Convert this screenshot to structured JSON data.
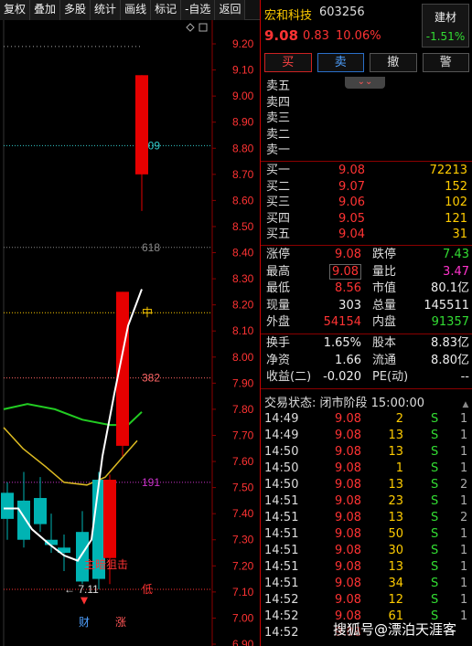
{
  "toolbar": {
    "buttons": [
      "复权",
      "叠加",
      "多股",
      "统计",
      "画线",
      "标记",
      "-自选",
      "返回"
    ]
  },
  "chart_data": {
    "type": "candlestick",
    "y_ticks": [
      "9.20",
      "9.10",
      "9.00",
      "8.90",
      "8.80",
      "8.70",
      "8.60",
      "8.50",
      "8.40",
      "8.30",
      "8.20",
      "8.10",
      "8.00",
      "7.90",
      "7.80",
      "7.70",
      "7.60",
      "7.50",
      "7.40",
      "7.30",
      "7.20",
      "7.10",
      "7.00",
      "6.90"
    ],
    "ylim": [
      6.9,
      9.25
    ],
    "candles": [
      {
        "open": 7.48,
        "close": 7.38,
        "high": 7.52,
        "low": 7.3
      },
      {
        "open": 7.45,
        "close": 7.3,
        "high": 7.56,
        "low": 7.27
      },
      {
        "open": 7.46,
        "close": 7.36,
        "high": 7.54,
        "low": 7.33
      },
      {
        "open": 7.3,
        "close": 7.28,
        "high": 7.4,
        "low": 7.25
      },
      {
        "open": 7.27,
        "close": 7.25,
        "high": 7.32,
        "low": 7.18
      },
      {
        "open": 7.33,
        "close": 7.14,
        "high": 7.41,
        "low": 7.13
      },
      {
        "open": 7.53,
        "close": 7.15,
        "high": 7.56,
        "low": 7.11
      },
      {
        "open": 7.23,
        "close": 7.53,
        "high": 7.55,
        "low": 7.13
      },
      {
        "open": 7.66,
        "close": 8.25,
        "high": 8.25,
        "low": 7.62
      },
      {
        "open": 8.7,
        "close": 9.08,
        "high": 9.08,
        "low": 8.56
      }
    ],
    "levels": [
      {
        "label": "809",
        "value": 8.81,
        "color": "#33cccc"
      },
      {
        "label": "618",
        "value": 8.42,
        "color": "#888888"
      },
      {
        "label": "中",
        "value": 8.17,
        "color": "#ffcc00"
      },
      {
        "label": "382",
        "value": 7.92,
        "color": "#ff6666"
      },
      {
        "label": "191",
        "value": 7.52,
        "color": "#cc33cc"
      },
      {
        "label": "低",
        "value": 7.11,
        "color": "#ff3333"
      }
    ],
    "low_marker": "7.11",
    "annotation": "主暗狙击",
    "bottom_marks": [
      "财",
      "涨"
    ]
  },
  "stock": {
    "name": "宏和科技",
    "code": "603256",
    "price": "9.08",
    "change": "0.83",
    "pct": "10.06%"
  },
  "sector": {
    "name": "建材",
    "pct": "-1.51%"
  },
  "trade_buttons": [
    "买",
    "卖",
    "撤",
    "警"
  ],
  "asks": [
    {
      "label": "卖五",
      "price": "",
      "vol": ""
    },
    {
      "label": "卖四",
      "price": "",
      "vol": ""
    },
    {
      "label": "卖三",
      "price": "",
      "vol": ""
    },
    {
      "label": "卖二",
      "price": "",
      "vol": ""
    },
    {
      "label": "卖一",
      "price": "",
      "vol": ""
    }
  ],
  "bids": [
    {
      "label": "买一",
      "price": "9.08",
      "vol": "72213"
    },
    {
      "label": "买二",
      "price": "9.07",
      "vol": "152"
    },
    {
      "label": "买三",
      "price": "9.06",
      "vol": "102"
    },
    {
      "label": "买四",
      "price": "9.05",
      "vol": "121"
    },
    {
      "label": "买五",
      "price": "9.04",
      "vol": "31"
    }
  ],
  "stats1": [
    {
      "l1": "涨停",
      "v1": "9.08",
      "l2": "跌停",
      "v2": "7.43"
    },
    {
      "l1": "最高",
      "v1": "9.08",
      "l2": "量比",
      "v2": "3.47"
    },
    {
      "l1": "最低",
      "v1": "8.56",
      "l2": "市值",
      "v2": "80.1亿"
    },
    {
      "l1": "现量",
      "v1": "303",
      "l2": "总量",
      "v2": "145511"
    },
    {
      "l1": "外盘",
      "v1": "54154",
      "l2": "内盘",
      "v2": "91357"
    }
  ],
  "stats2": [
    {
      "l1": "换手",
      "v1": "1.65%",
      "l2": "股本",
      "v2": "8.83亿"
    },
    {
      "l1": "净资",
      "v1": "1.66",
      "l2": "流通",
      "v2": "8.80亿"
    },
    {
      "l1": "收益(二)",
      "v1": "-0.020",
      "l2": "PE(动)",
      "v2": "--"
    }
  ],
  "status": "交易状态: 闭市阶段 15:00:00",
  "ticks": [
    {
      "t": "14:49",
      "p": "9.08",
      "v": "2",
      "s": "S",
      "n": "1"
    },
    {
      "t": "14:49",
      "p": "9.08",
      "v": "13",
      "s": "S",
      "n": "1"
    },
    {
      "t": "14:50",
      "p": "9.08",
      "v": "13",
      "s": "S",
      "n": "1"
    },
    {
      "t": "14:50",
      "p": "9.08",
      "v": "1",
      "s": "S",
      "n": "1"
    },
    {
      "t": "14:50",
      "p": "9.08",
      "v": "13",
      "s": "S",
      "n": "2"
    },
    {
      "t": "14:51",
      "p": "9.08",
      "v": "23",
      "s": "S",
      "n": "1"
    },
    {
      "t": "14:51",
      "p": "9.08",
      "v": "13",
      "s": "S",
      "n": "2"
    },
    {
      "t": "14:51",
      "p": "9.08",
      "v": "50",
      "s": "S",
      "n": "1"
    },
    {
      "t": "14:51",
      "p": "9.08",
      "v": "30",
      "s": "S",
      "n": "1"
    },
    {
      "t": "14:51",
      "p": "9.08",
      "v": "13",
      "s": "S",
      "n": "1"
    },
    {
      "t": "14:51",
      "p": "9.08",
      "v": "34",
      "s": "S",
      "n": "1"
    },
    {
      "t": "14:52",
      "p": "9.08",
      "v": "12",
      "s": "S",
      "n": "1"
    },
    {
      "t": "14:52",
      "p": "9.08",
      "v": "61",
      "s": "S",
      "n": "1"
    },
    {
      "t": "14:52",
      "p": "9.08",
      "v": "",
      "s": "",
      "n": ""
    }
  ],
  "watermark": "搜狐号@漂泊天涯客"
}
